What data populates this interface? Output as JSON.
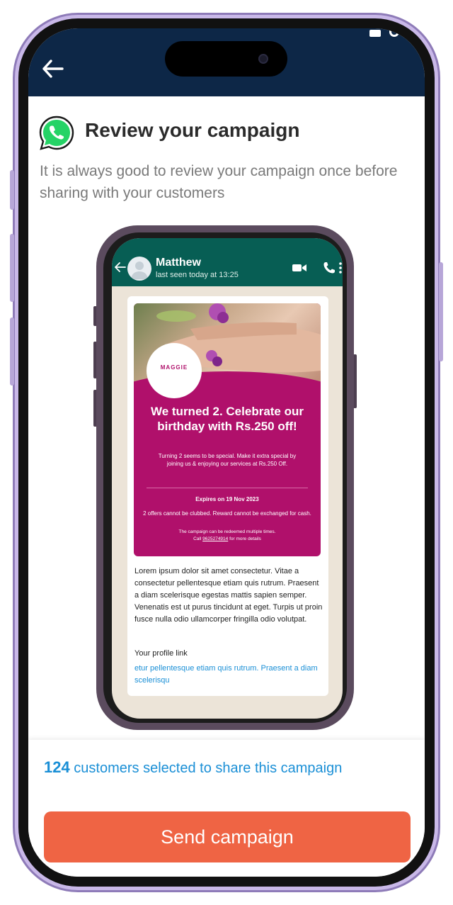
{
  "header": {
    "back_icon": "arrow-left-icon",
    "color": "#0d2747"
  },
  "title": "Review your campaign",
  "subtitle": "It is always good to review your campaign once before sharing with your customers",
  "preview": {
    "contact_name": "Matthew",
    "last_seen": "last seen today at 13:25",
    "promo": {
      "brand": "MAGGIE",
      "headline": "We turned 2. Celebrate our birthday with Rs.250 off!",
      "body": "Turning 2 seems to be special. Make it extra special by joining us & enjoying our services at Rs.250 Off.",
      "expiry": "Expires on 19 Nov 2023",
      "note": "2 offers cannot be clubbed. Reward cannot be exchanged for cash.",
      "redeem": "The campaign can be redeemed multiple times.",
      "call_prefix": "Call ",
      "phone": "9625274914",
      "call_suffix": " for more details",
      "color": "#b0106b"
    },
    "message": "Lorem ipsum dolor sit amet consectetur. Vitae a consectetur pellentesque etiam quis rutrum. Praesent a diam scelerisque egestas mattis sapien semper. Venenatis est ut purus tincidunt at eget. Turpis ut proin fusce nulla odio ullamcorper fringilla odio volutpat.",
    "profile_link_label": "Your profile link",
    "profile_link": "etur pellentesque etiam quis rutrum. Praesent a diam scelerisqu"
  },
  "footer": {
    "customer_count": "124",
    "customer_text": "customers selected to share this campaign",
    "send_label": "Send campaign",
    "send_color": "#ef6444"
  }
}
